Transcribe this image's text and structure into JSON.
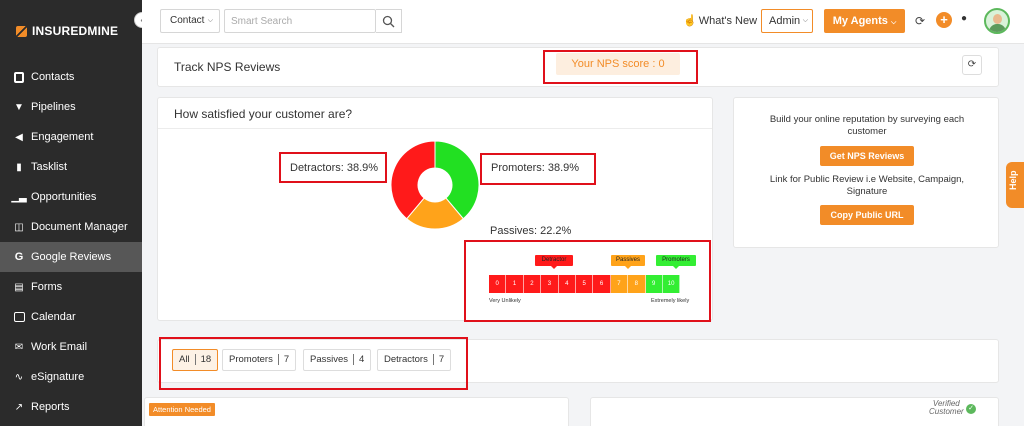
{
  "sidebar": {
    "logo_bold": "INSUREDMINE",
    "collapse_icon": "chevron-left-icon",
    "items": [
      {
        "label": "Contacts",
        "icon": "contact-card-icon"
      },
      {
        "label": "Pipelines",
        "icon": "funnel-icon"
      },
      {
        "label": "Engagement",
        "icon": "megaphone-icon"
      },
      {
        "label": "Tasklist",
        "icon": "clipboard-icon"
      },
      {
        "label": "Opportunities",
        "icon": "bar-chart-icon"
      },
      {
        "label": "Document Manager",
        "icon": "folder-icon"
      },
      {
        "label": "Google Reviews",
        "icon": "google-icon",
        "active": true
      },
      {
        "label": "Forms",
        "icon": "form-icon"
      },
      {
        "label": "Calendar",
        "icon": "calendar-icon"
      },
      {
        "label": "Work Email",
        "icon": "envelope-icon"
      },
      {
        "label": "eSignature",
        "icon": "signature-icon"
      },
      {
        "label": "Reports",
        "icon": "line-chart-icon"
      }
    ]
  },
  "topbar": {
    "contact_select": "Contact",
    "search_placeholder": "Smart Search",
    "whats_new": "What's New",
    "admin_select": "Admin",
    "agents_button": "My Agents"
  },
  "nps": {
    "title": "Track NPS Reviews",
    "score": "Your NPS score : 0"
  },
  "satisfaction": {
    "title": "How satisfied your customer are?",
    "scale_tags": {
      "detractor": "Detractor",
      "passives": "Passives",
      "promoters": "Promoters"
    },
    "scale_numbers": [
      "0",
      "1",
      "2",
      "3",
      "4",
      "5",
      "6",
      "7",
      "8",
      "9",
      "10"
    ],
    "scale_low": "Very Unlikely",
    "scale_high": "Extremely likely"
  },
  "chart_data": {
    "type": "pie",
    "donut": true,
    "labels": [
      "Detractors: 38.9%",
      "Promoters: 38.9%",
      "Passives: 22.2%"
    ],
    "slices": [
      {
        "name": "Detractors",
        "value": 38.9,
        "color": "#ff1a1a"
      },
      {
        "name": "Promoters",
        "value": 38.9,
        "color": "#22e022"
      },
      {
        "name": "Passives",
        "value": 22.2,
        "color": "#ffa31a"
      }
    ]
  },
  "reputation": {
    "text1": "Build your online reputation by surveying each customer",
    "button1": "Get NPS Reviews",
    "text2": "Link for Public Review i.e Website, Campaign, Signature",
    "button2": "Copy Public URL"
  },
  "filters": [
    {
      "label": "All",
      "count": "18",
      "active": true
    },
    {
      "label": "Promoters",
      "count": "7"
    },
    {
      "label": "Passives",
      "count": "4"
    },
    {
      "label": "Detractors",
      "count": "7"
    }
  ],
  "reviews": {
    "attention": "Attention Needed",
    "verified_line1": "Verified",
    "verified_line2": "Customer"
  },
  "help_tab": "Help",
  "colors": {
    "accent": "#f28c28",
    "sidebar": "#2b2b2b",
    "highlight": "#e0101a"
  }
}
